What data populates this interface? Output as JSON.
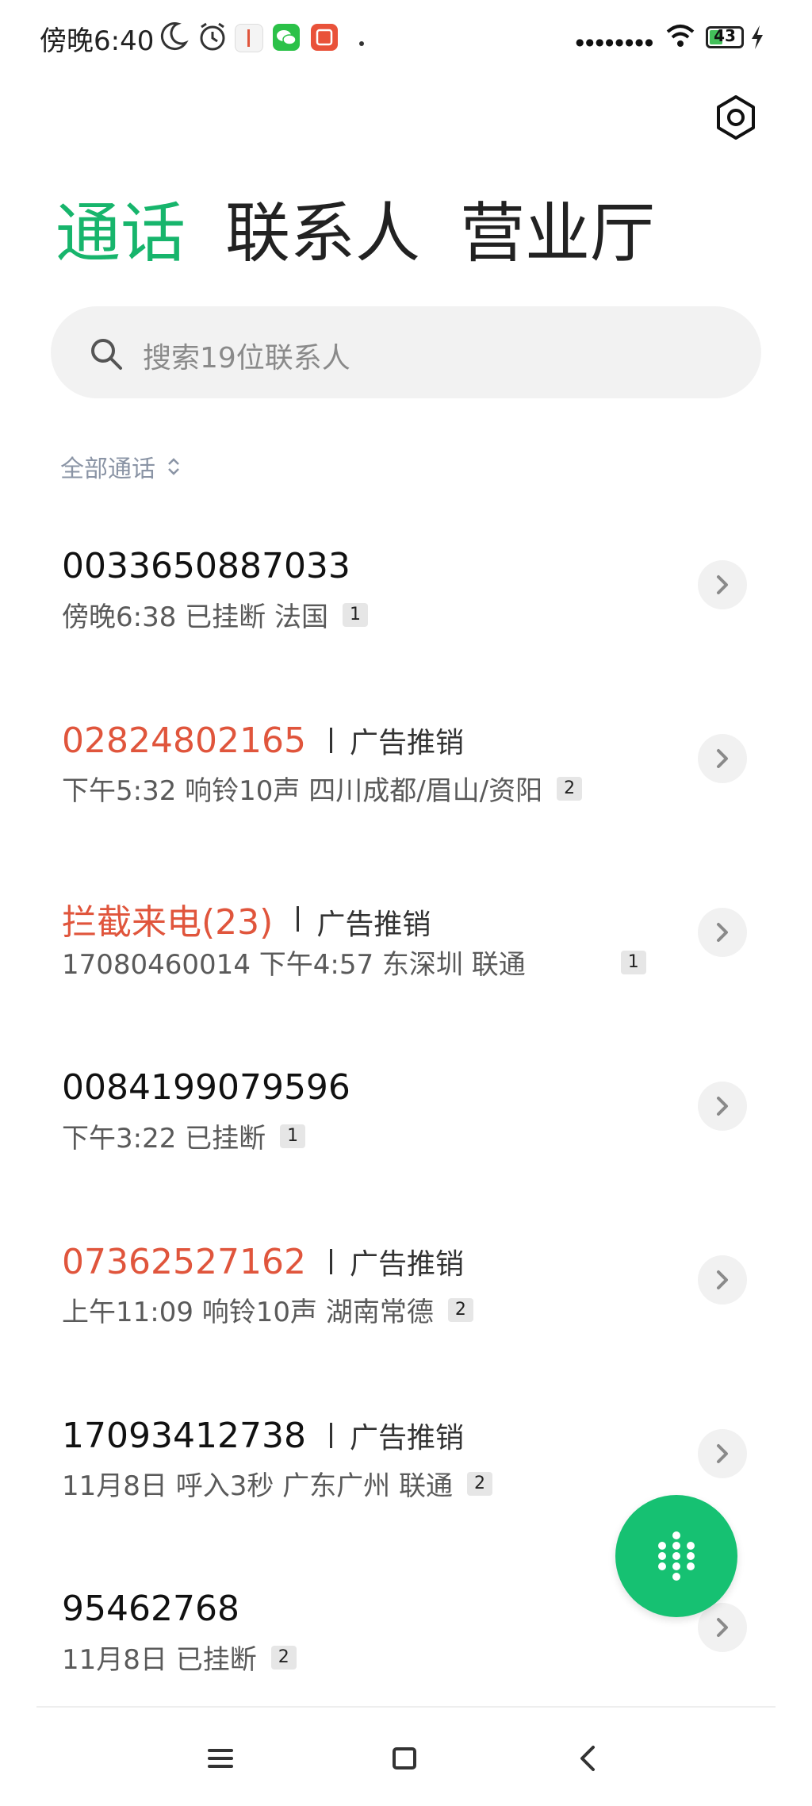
{
  "status_bar": {
    "time": "傍晚6:40",
    "battery_level": 43,
    "battery_text": "43",
    "signal_dots": "●●●●●●●●"
  },
  "tabs": [
    {
      "label": "通话",
      "active": true
    },
    {
      "label": "联系人",
      "active": false
    },
    {
      "label": "营业厅",
      "active": false
    }
  ],
  "search": {
    "placeholder": "搜索19位联系人"
  },
  "filter": {
    "label": "全部通话"
  },
  "calls": [
    {
      "number": "0033650887033",
      "spam": false,
      "tag": "",
      "detail": "傍晚6:38   已挂断 法国",
      "count": "1"
    },
    {
      "number": "02824802165",
      "spam": true,
      "tag": "广告推销",
      "detail": "下午5:32   响铃10声 四川成都/眉山/资阳",
      "count": "2"
    },
    {
      "number": "拦截来电(23)",
      "spam": true,
      "tag": "广告推销",
      "detail": "17080460014  下午4:57   东深圳 联通",
      "count": "1"
    },
    {
      "number": "0084199079596",
      "spam": false,
      "tag": "",
      "detail": "下午3:22   已挂断",
      "count": "1"
    },
    {
      "number": "07362527162",
      "spam": true,
      "tag": "广告推销",
      "detail": "上午11:09   响铃10声 湖南常德",
      "count": "2"
    },
    {
      "number": "17093412738",
      "spam": false,
      "tag": "广告推销",
      "detail": "11月8日   呼入3秒 广东广州 联通",
      "count": "2"
    },
    {
      "number": "95462768",
      "spam": false,
      "tag": "",
      "detail": "11月8日   已挂断",
      "count": "2"
    }
  ],
  "colors": {
    "accent_green": "#17b56c",
    "spam_red": "#e0553c",
    "fab_green": "#16c172"
  }
}
